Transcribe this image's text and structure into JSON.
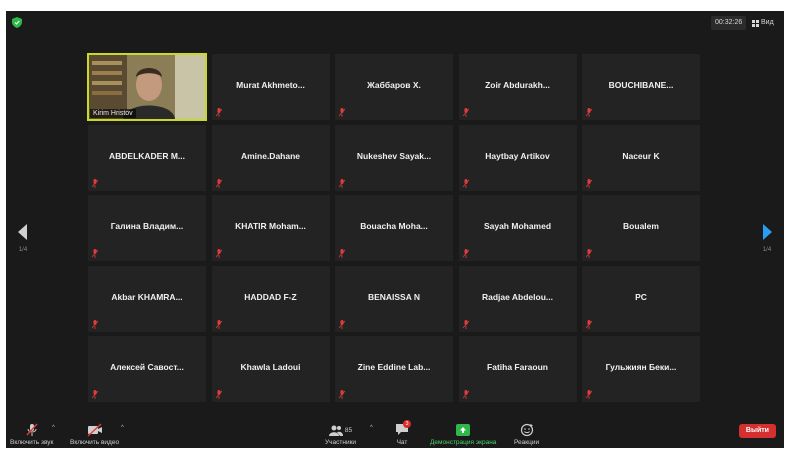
{
  "header": {
    "timer": "00:32:26",
    "view_label": "Вид"
  },
  "participants": [
    {
      "name": "Kirim Hristov",
      "video": true,
      "muted": false
    },
    {
      "name": "Murat Akhmeto...",
      "muted": true
    },
    {
      "name": "Жаббаров Х.",
      "muted": true
    },
    {
      "name": "Zoir Abdurakh...",
      "muted": true
    },
    {
      "name": "BOUCHIBANE...",
      "muted": true
    },
    {
      "name": "ABDELKADER M...",
      "muted": true
    },
    {
      "name": "Amine.Dahane",
      "muted": true
    },
    {
      "name": "Nukeshev Sayak...",
      "muted": true
    },
    {
      "name": "Haytbay Artikov",
      "muted": true
    },
    {
      "name": "Naceur K",
      "muted": true
    },
    {
      "name": "Галина Владим...",
      "muted": true
    },
    {
      "name": "KHATIR Moham...",
      "muted": true
    },
    {
      "name": "Bouacha Moha...",
      "muted": true
    },
    {
      "name": "Sayah Mohamed",
      "muted": true
    },
    {
      "name": "Boualem",
      "muted": true
    },
    {
      "name": "Akbar KHAMRA...",
      "muted": true
    },
    {
      "name": "HADDAD F-Z",
      "muted": true
    },
    {
      "name": "BENAISSA N",
      "muted": true
    },
    {
      "name": "Radjae Abdelou...",
      "muted": true
    },
    {
      "name": "PC",
      "muted": true
    },
    {
      "name": "Алексей Савост...",
      "muted": true
    },
    {
      "name": "Khawla Ladoui",
      "muted": true
    },
    {
      "name": "Zine Eddine Lab...",
      "muted": true
    },
    {
      "name": "Fatiha Faraoun",
      "muted": true
    },
    {
      "name": "Гульжиян Беки...",
      "muted": true
    }
  ],
  "pagination": {
    "left": "1/4",
    "right": "1/4"
  },
  "toolbar": {
    "audio_label": "Включить звук",
    "video_label": "Включить видео",
    "participants_label": "Участники",
    "participants_count": "85",
    "chat_label": "Чат",
    "chat_badge": "3",
    "share_label": "Демонстрация экрана",
    "reactions_label": "Реакции",
    "leave_label": "Выйти"
  },
  "colors": {
    "background": "#1a1a1a",
    "tile": "#232323",
    "active_speaker": "#c8d92a",
    "muted_icon": "#e03c3c",
    "share_green": "#2fb84a",
    "leave_red": "#d43030"
  }
}
